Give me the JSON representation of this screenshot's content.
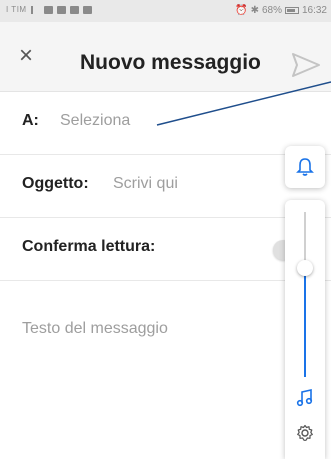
{
  "status_bar": {
    "carrier": "I TIM",
    "battery": "68%",
    "time": "16:32"
  },
  "app_bar": {
    "close_label": "×",
    "title": "Nuovo messaggio"
  },
  "form": {
    "to_label": "A:",
    "to_placeholder": "Seleziona",
    "subject_label": "Oggetto:",
    "subject_placeholder": "Scrivi qui",
    "read_receipt_label": "Conferma lettura:",
    "body_placeholder": "Testo del messaggio"
  },
  "volume_panel": {
    "level": 0.64
  },
  "colors": {
    "accent": "#1a73e8",
    "placeholder": "#9e9e9e",
    "annotation": "#1f4e8c"
  },
  "icons": {
    "close": "close-icon",
    "send": "send-icon",
    "bell": "bell-icon",
    "note": "music-note-icon",
    "gear": "gear-icon"
  }
}
